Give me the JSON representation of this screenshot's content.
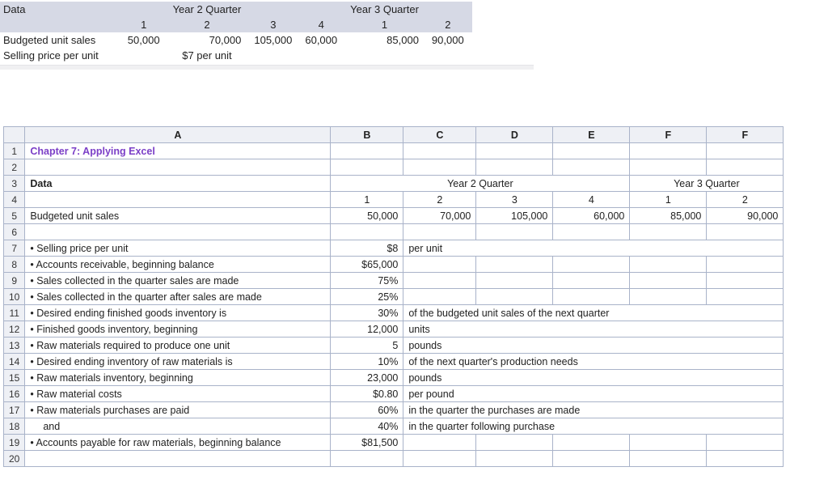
{
  "top_table": {
    "title": "Data",
    "year2_label": "Year 2 Quarter",
    "year3_label": "Year 3 Quarter",
    "q_labels": [
      "1",
      "2",
      "3",
      "4",
      "1",
      "2"
    ],
    "row_budgeted_label": "Budgeted unit sales",
    "row_budgeted_values": [
      "50,000",
      "70,000",
      "105,000",
      "60,000",
      "85,000",
      "90,000"
    ],
    "row_price_label": "Selling price per unit",
    "row_price_value": "$7 per unit"
  },
  "sheet": {
    "col_headers": [
      "A",
      "B",
      "C",
      "D",
      "E",
      "F",
      "F"
    ],
    "rows": {
      "r1": {
        "A": "Chapter 7: Applying Excel"
      },
      "r3": {
        "A": "Data",
        "BCDE_merge": "Year 2 Quarter",
        "FG_merge": "Year 3 Quarter"
      },
      "r4": {
        "B": "1",
        "C": "2",
        "D": "3",
        "E": "4",
        "F": "1",
        "G": "2"
      },
      "r5": {
        "A": "Budgeted unit sales",
        "B": "50,000",
        "C": "70,000",
        "D": "105,000",
        "E": "60,000",
        "F": "85,000",
        "G": "90,000"
      },
      "r7": {
        "A": "• Selling price per unit",
        "B": "$8",
        "C": "per unit"
      },
      "r8": {
        "A": "• Accounts receivable, beginning balance",
        "B": "$65,000"
      },
      "r9": {
        "A": "• Sales collected in the quarter sales are made",
        "B": "75%"
      },
      "r10": {
        "A": "• Sales collected in the quarter after sales are made",
        "B": "25%"
      },
      "r11": {
        "A": "• Desired ending finished goods inventory is",
        "B": "30%",
        "C": "of the budgeted unit sales of the next quarter"
      },
      "r12": {
        "A": "• Finished goods inventory, beginning",
        "B": "12,000",
        "C": "units"
      },
      "r13": {
        "A": "• Raw materials required to produce one unit",
        "B": "5",
        "C": "pounds"
      },
      "r14": {
        "A": "• Desired ending inventory of raw materials is",
        "B": "10%",
        "C": "of the next quarter's production needs"
      },
      "r15": {
        "A": "• Raw materials inventory, beginning",
        "B": "23,000",
        "C": "pounds"
      },
      "r16": {
        "A": "• Raw material costs",
        "B": "$0.80",
        "C": "per pound"
      },
      "r17": {
        "A": "• Raw materials purchases are paid",
        "B": "60%",
        "C": "in the quarter the purchases are made"
      },
      "r18": {
        "A": "    and",
        "B": "40%",
        "C": "in the quarter following purchase"
      },
      "r19": {
        "A": "• Accounts payable for raw materials, beginning balance",
        "B": "$81,500"
      }
    }
  }
}
